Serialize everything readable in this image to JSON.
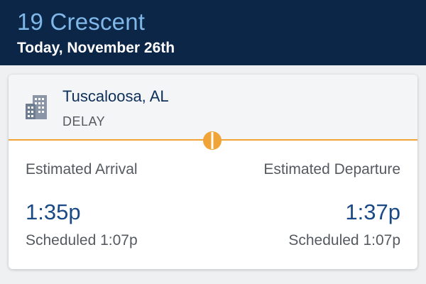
{
  "header": {
    "train_name": "19 Crescent",
    "date": "Today, November 26th"
  },
  "stop": {
    "station": "Tuscaloosa, AL",
    "status": "DELAY",
    "icon": "building-icon",
    "arrival": {
      "label": "Estimated Arrival",
      "time": "1:35p",
      "scheduled": "Scheduled 1:07p"
    },
    "departure": {
      "label": "Estimated Departure",
      "time": "1:37p",
      "scheduled": "Scheduled 1:07p"
    }
  },
  "colors": {
    "header_bg": "#0c2648",
    "title": "#7fb8e8",
    "accent": "#f0a336",
    "time": "#1a4a86"
  }
}
